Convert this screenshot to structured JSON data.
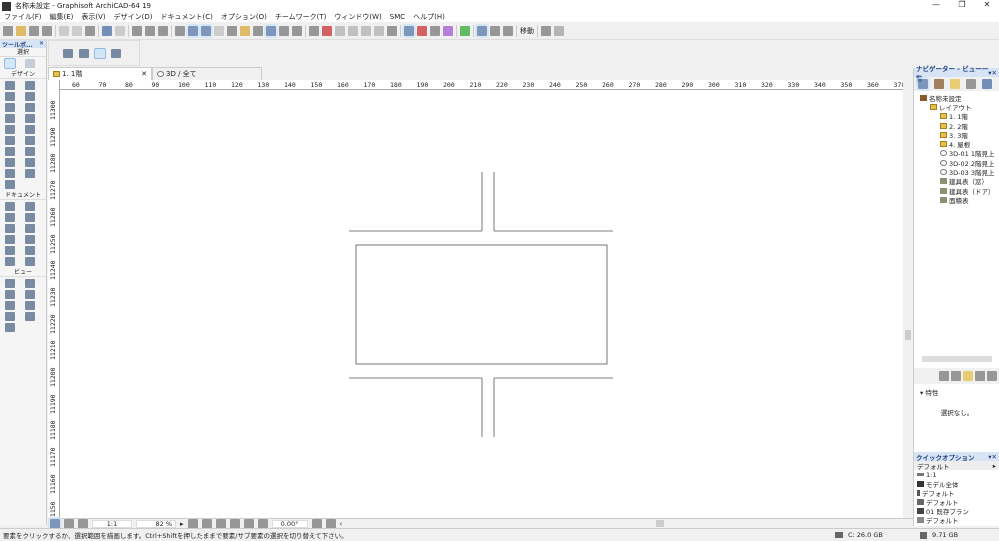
{
  "title": "名称未設定 - Graphisoft ArchiCAD-64 19",
  "window_controls": [
    "—",
    "❐",
    "✕"
  ],
  "menu": [
    "ファイル(F)",
    "編集(E)",
    "表示(V)",
    "デザイン(D)",
    "ドキュメント(C)",
    "オプション(O)",
    "チームワーク(T)",
    "ウィンドウ(W)",
    "SMC",
    "ヘルプ(H)"
  ],
  "toolbar": {
    "move_label": "移動"
  },
  "toolbox": {
    "title": "ツールボ...",
    "select": "選択",
    "design": "デザイン",
    "document": "ドキュメント",
    "view": "ビュー"
  },
  "tabs": [
    {
      "label": "1. 1階",
      "active": true
    },
    {
      "label": "3D / 全て",
      "active": false
    }
  ],
  "rulers": {
    "horizontal": [
      "60",
      "70",
      "80",
      "90",
      "100",
      "110",
      "120",
      "130",
      "140",
      "150",
      "160",
      "170",
      "180",
      "190",
      "200",
      "210",
      "220",
      "230",
      "240",
      "250",
      "260",
      "270",
      "280",
      "290",
      "300",
      "310",
      "320",
      "330",
      "340",
      "350",
      "360",
      "370"
    ],
    "vertical": [
      "11300",
      "11290",
      "11280",
      "11270",
      "11260",
      "11250",
      "11240",
      "11230",
      "11220",
      "11210",
      "11200",
      "11190",
      "11180",
      "11170",
      "11160",
      "11150"
    ]
  },
  "bottombar": {
    "scale": "1:1",
    "zoom": "82 %",
    "angle": "0.00°"
  },
  "status": {
    "hint": "要素をクリックするか、選択範囲を描画します。Ctrl+Shiftを押したままで要素/サブ要素の選択を切り替えて下さい。",
    "disk": "C: 26.0 GB",
    "memory": "9.71 GB"
  },
  "navigator": {
    "title": "ナビゲーター - ビュー一覧",
    "tree": [
      {
        "label": "名称未設定",
        "icon": "project",
        "level": 0
      },
      {
        "label": "レイアウト",
        "icon": "folder",
        "level": 1
      },
      {
        "label": "1. 1階",
        "icon": "folder",
        "level": 2
      },
      {
        "label": "2. 2階",
        "icon": "folder",
        "level": 2
      },
      {
        "label": "3. 3階",
        "icon": "folder",
        "level": 2
      },
      {
        "label": "4. 屋根",
        "icon": "folder",
        "level": 2
      },
      {
        "label": "3D-01 1階見上",
        "icon": "3d",
        "level": 2
      },
      {
        "label": "3D-02 2階見上",
        "icon": "3d",
        "level": 2
      },
      {
        "label": "3D-03 3階見上",
        "icon": "3d",
        "level": 2
      },
      {
        "label": "建具表（窓）",
        "icon": "schedule",
        "level": 2
      },
      {
        "label": "建具表（ドア）",
        "icon": "schedule",
        "level": 2
      },
      {
        "label": "面積表",
        "icon": "schedule",
        "level": 2
      }
    ],
    "properties_label": "特性",
    "no_selection": "選択なし。"
  },
  "quick_options": {
    "title": "クイックオプション",
    "preset": "デフォルト",
    "rows": [
      "1:1",
      "モデル全体",
      "デフォルト",
      "デフォルト",
      "01 既存プラン",
      "デフォルト"
    ]
  }
}
